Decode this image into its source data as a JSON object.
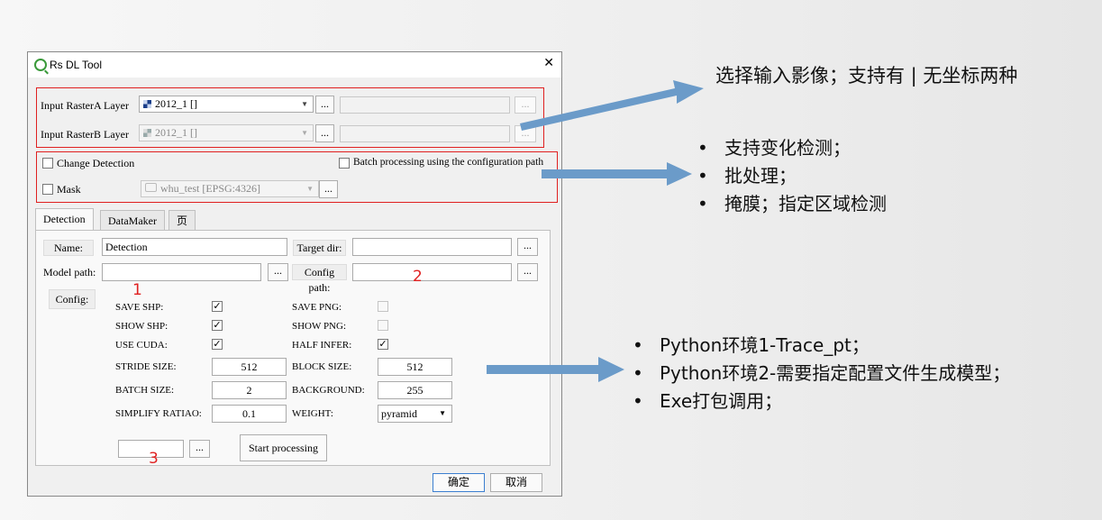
{
  "dialog": {
    "title": "Rs DL Tool",
    "close_glyph": "✕",
    "rasterA": {
      "label": "Input RasterA  Layer",
      "value": "2012_1 []",
      "more": "..."
    },
    "rasterB": {
      "label": "Input RasterB  Layer",
      "value": "2012_1 []",
      "more": "..."
    },
    "change_detection": {
      "label": "Change Detection",
      "checked": false
    },
    "batch": {
      "label": "Batch processing using the configuration path",
      "checked": false
    },
    "mask": {
      "label": "Mask",
      "value": "whu_test [EPSG:4326]",
      "checked": false
    },
    "tabs": [
      "Detection",
      "DataMaker",
      "页"
    ],
    "detection": {
      "name_label": "Name:",
      "name_value": "Detection",
      "target_label": "Target dir:",
      "target_value": "",
      "model_label": "Model path:",
      "model_value": "",
      "config_path_label": "Config path:",
      "config_path_value": "",
      "config_label": "Config:",
      "options": {
        "save_shp": {
          "label": "SAVE SHP:",
          "checked": true
        },
        "show_shp": {
          "label": "SHOW SHP:",
          "checked": true
        },
        "use_cuda": {
          "label": "USE CUDA:",
          "checked": true
        },
        "save_png": {
          "label": "SAVE PNG:",
          "checked": false
        },
        "show_png": {
          "label": "SHOW PNG:",
          "checked": false
        },
        "half_infer": {
          "label": "HALF INFER:",
          "checked": true
        }
      },
      "stride_label": "STRIDE SIZE:",
      "stride_value": "512",
      "block_label": "BLOCK SIZE:",
      "block_value": "512",
      "batch_label": "BATCH SIZE:",
      "batch_value": "2",
      "background_label": "BACKGROUND:",
      "background_value": "255",
      "simplify_label": "SIMPLIFY RATIAO:",
      "simplify_value": "0.1",
      "weight_label": "WEIGHT:",
      "weight_value": "pyramid",
      "output_value": "",
      "start_label": "Start processing",
      "ellipsis": "..."
    },
    "ok_label": "确定",
    "cancel_label": "取消"
  },
  "annotations": {
    "num1": "1",
    "num2": "2",
    "num3": "3",
    "note_top": "选择输入影像；支持有 | 无坐标两种",
    "note_mid": [
      "支持变化检测；",
      "批处理；",
      "掩膜；指定区域检测"
    ],
    "note_bottom": [
      "Python环境1-Trace_pt；",
      "Python环境2-需要指定配置文件生成模型；",
      "Exe打包调用；"
    ],
    "bullet": "•",
    "red": "#e02020",
    "arrow_color": "#6b9bc9"
  }
}
